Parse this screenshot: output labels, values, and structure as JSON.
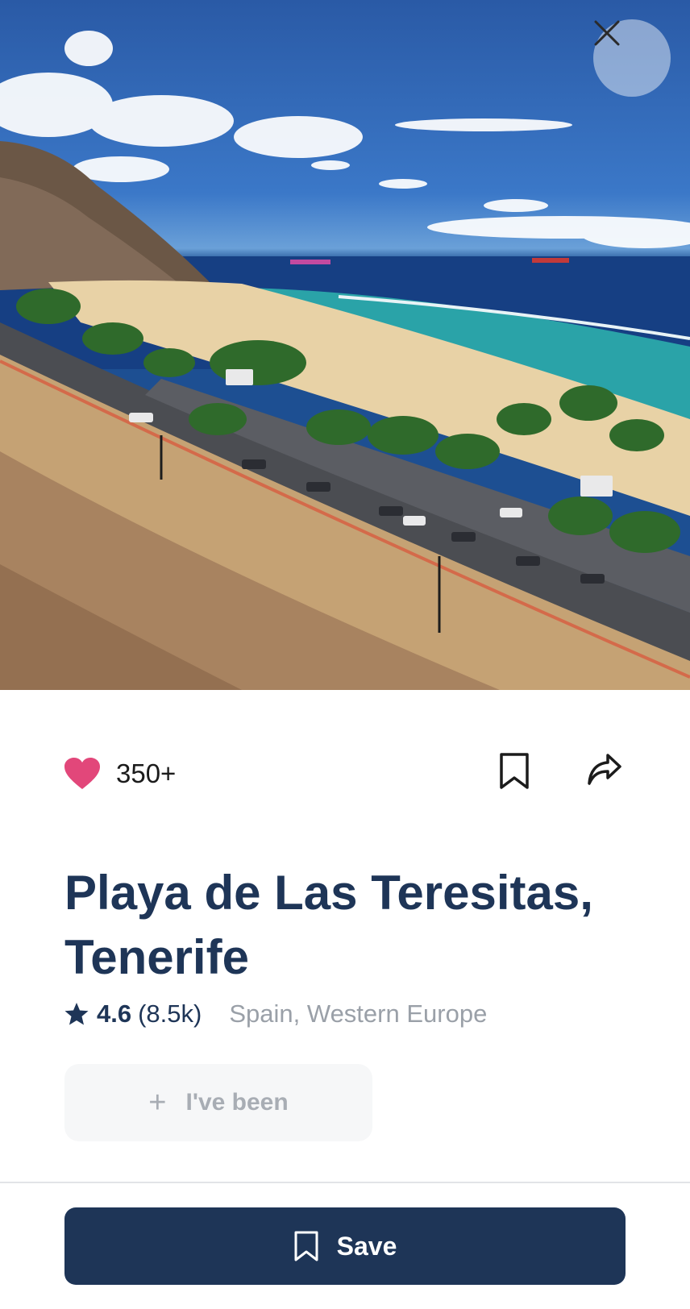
{
  "hero": {
    "image": "beach-landscape",
    "close_icon": "close-icon"
  },
  "actions": {
    "like_icon": "heart-icon",
    "like_count": "350+",
    "bookmark_icon": "bookmark-icon",
    "share_icon": "share-icon"
  },
  "place": {
    "title": "Playa de Las Teresitas, Tenerife",
    "rating_icon": "star-icon",
    "rating": "4.6",
    "review_count": "(8.5k)",
    "location": "Spain, Western Europe"
  },
  "been_button": {
    "icon": "plus-icon",
    "label": "I've been"
  },
  "save_button": {
    "icon": "bookmark-icon",
    "label": "Save"
  },
  "colors": {
    "brand_navy": "#1e3557",
    "heart_pink": "#e2477a",
    "muted_text": "#9aa0a8"
  }
}
